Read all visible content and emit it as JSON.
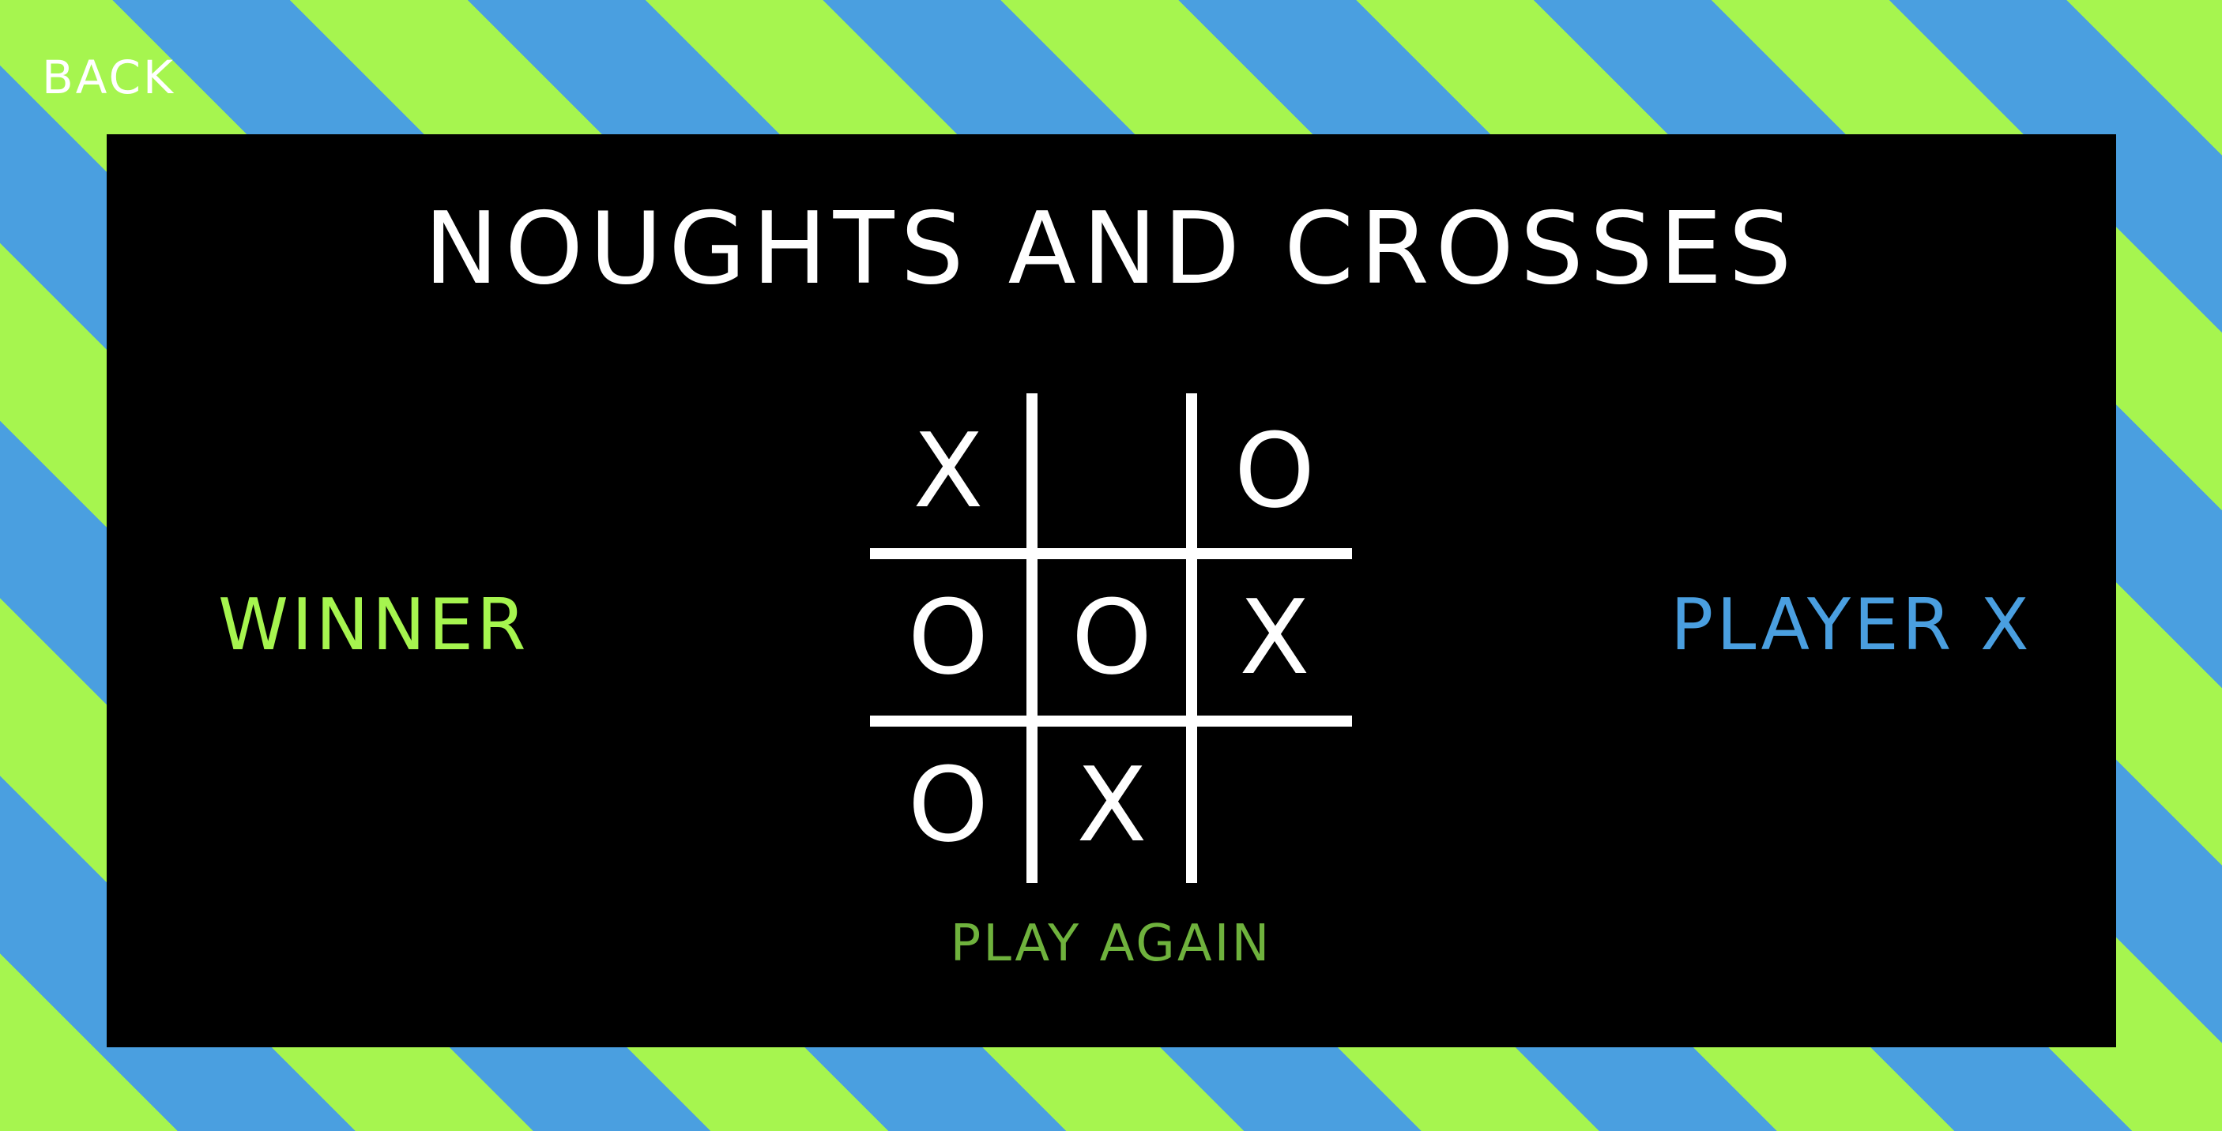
{
  "nav": {
    "back_label": "BACK"
  },
  "game": {
    "title": "NOUGHTS AND CROSSES",
    "result_label": "WINNER",
    "winner": "PLAYER X",
    "play_again_label": "PLAY AGAIN",
    "board": [
      "X",
      "",
      "O",
      "O",
      "O",
      "X",
      "O",
      "X",
      ""
    ]
  },
  "colors": {
    "stripe_green": "#a6f54f",
    "stripe_blue": "#4a9fe0",
    "panel_background": "#000000",
    "winner_label_color": "#a6f54f",
    "winner_name_color": "#4a9fe0",
    "play_again_color": "#6fb23d"
  }
}
